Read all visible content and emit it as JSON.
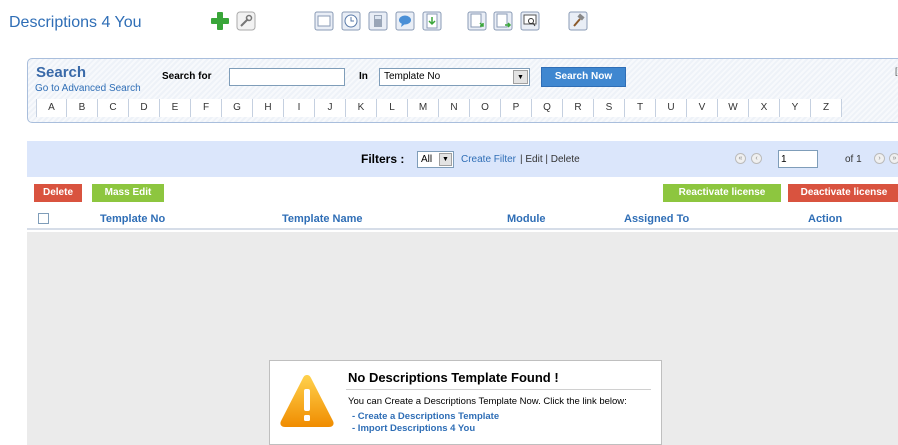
{
  "title": "Descriptions 4 You",
  "search": {
    "heading": "Search",
    "advanced_link": "Go to Advanced Search",
    "search_for_label": "Search for",
    "input_value": "",
    "in_label": "In",
    "in_selected": "Template No",
    "button": "Search Now",
    "close": "[x"
  },
  "alphabet": [
    "A",
    "B",
    "C",
    "D",
    "E",
    "F",
    "G",
    "H",
    "I",
    "J",
    "K",
    "L",
    "M",
    "N",
    "O",
    "P",
    "Q",
    "R",
    "S",
    "T",
    "U",
    "V",
    "W",
    "X",
    "Y",
    "Z"
  ],
  "filters": {
    "label": "Filters :",
    "selected": "All",
    "create_filter": "Create Filter",
    "edit_delete": "| Edit | Delete"
  },
  "pagination": {
    "page": "1",
    "of_text": "of 1"
  },
  "actions": {
    "delete": "Delete",
    "mass_edit": "Mass Edit",
    "reactivate": "Reactivate license",
    "deactivate": "Deactivate license"
  },
  "table": {
    "columns": [
      "Template No",
      "Template Name",
      "Module",
      "Assigned To",
      "Action"
    ]
  },
  "notice": {
    "title": "No Descriptions Template Found !",
    "text": "You can Create a Descriptions Template Now. Click the link below:",
    "link1": "- Create a Descriptions Template",
    "link2": "- Import Descriptions 4 You"
  },
  "colors": {
    "accent_blue": "#2f6eb6",
    "delete_red": "#d9533f",
    "action_green": "#8dc63f",
    "filter_bar": "#dbe6fb"
  },
  "icons": [
    "add-icon",
    "wrench-icon",
    "window-icon",
    "clock-icon",
    "calculator-icon",
    "chat-icon",
    "import-icon",
    "export-icon",
    "export-alt-icon",
    "preview-icon",
    "settings-hammer-icon",
    "warning-icon"
  ]
}
